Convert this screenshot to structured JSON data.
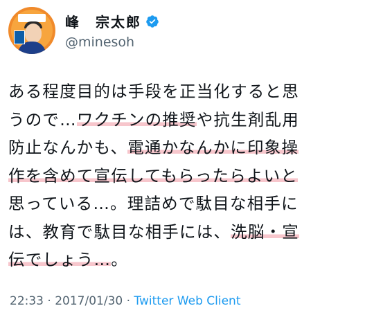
{
  "author": {
    "display_name": "峰　宗太郎",
    "handle": "@minesoh",
    "verified": true,
    "avatar_icon": "profile-photo"
  },
  "tweet": {
    "lines": [
      [
        {
          "text": "ある程度目的は手段を正当化すると思",
          "hl": false
        }
      ],
      [
        {
          "text": "うので…",
          "hl": false
        },
        {
          "text": "ワクチンの推奨",
          "hl": true
        },
        {
          "text": "や抗生剤乱用",
          "hl": false
        }
      ],
      [
        {
          "text": "防止なんかも、",
          "hl": false
        },
        {
          "text": "電通かなんかに印象操",
          "hl": true
        }
      ],
      [
        {
          "text": "作を含めて宣伝してもらったらよいと",
          "hl": true
        }
      ],
      [
        {
          "text": "思っている…。理詰めで駄目な相手に",
          "hl": false
        }
      ],
      [
        {
          "text": "は、教育で駄目な相手には、",
          "hl": false
        },
        {
          "text": "洗脳・宣",
          "hl": true
        }
      ],
      [
        {
          "text": "伝でしょう…",
          "hl": true
        },
        {
          "text": "。",
          "hl": false
        }
      ]
    ],
    "highlight_color": "#f7c6cc"
  },
  "meta": {
    "time": "22:33",
    "separator": " · ",
    "date": "2017/01/30",
    "client": "Twitter Web Client",
    "client_color": "#1d9bf0"
  }
}
